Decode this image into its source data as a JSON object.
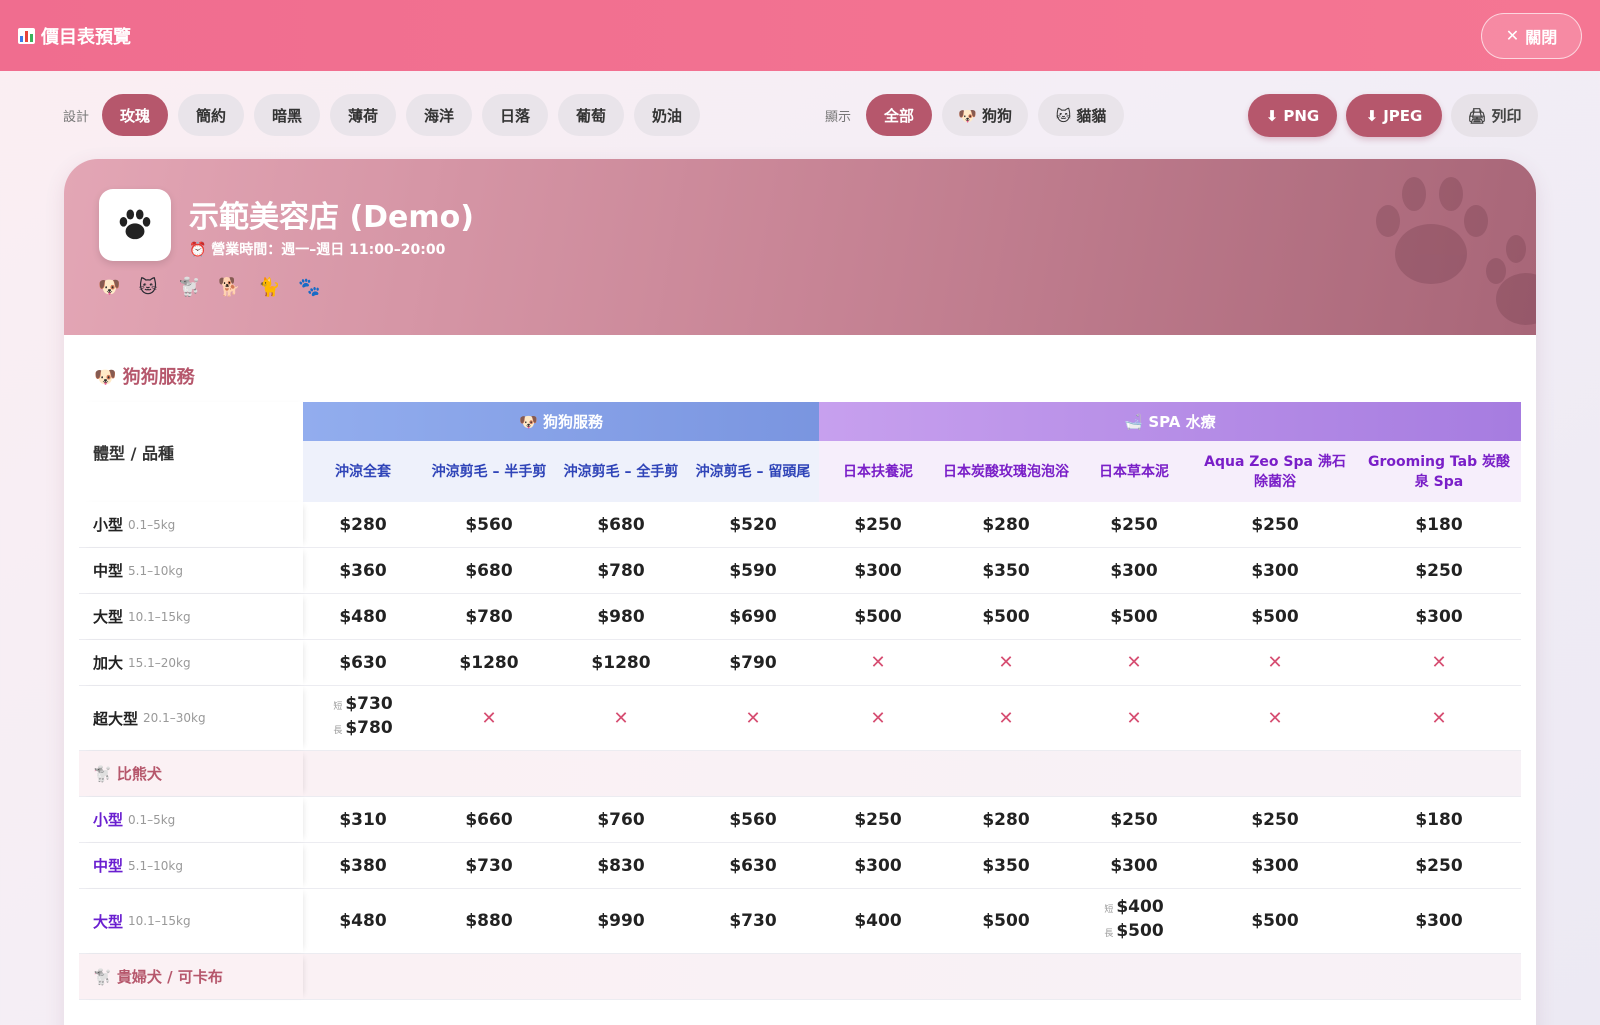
{
  "window": {
    "title": "價目表預覽",
    "close_label": "關閉"
  },
  "toolbar": {
    "design_label": "設計",
    "themes": [
      "玫瑰",
      "簡約",
      "暗黑",
      "薄荷",
      "海洋",
      "日落",
      "葡萄",
      "奶油"
    ],
    "active_theme": "玫瑰",
    "display_label": "顯示",
    "filters": [
      "全部",
      "🐶 狗狗",
      "🐱 貓貓"
    ],
    "active_filter": "全部",
    "png_label": "PNG",
    "jpeg_label": "JPEG",
    "print_label": "列印"
  },
  "shop": {
    "name": "示範美容店 (Demo)",
    "hours": "⏰ 營業時間：週一–週日 11:00–20:00",
    "emojis": [
      "🐶",
      "🐱",
      "🐩",
      "🐕",
      "🐈",
      "🐾"
    ]
  },
  "section": {
    "title": "🐶 狗狗服務"
  },
  "table": {
    "label_header": "體型 / 品種",
    "groups": [
      {
        "name": "🐶 狗狗服務",
        "span": 4,
        "color": "#7f9ae6"
      },
      {
        "name": "🛁 SPA 水療",
        "span": 5,
        "color": "#b98ce8"
      }
    ],
    "columns": [
      "沖涼全套",
      "沖涼剪毛 – 半手剪",
      "沖涼剪毛 – 全手剪",
      "沖涼剪毛 – 留頭尾",
      "日本扶養泥",
      "日本炭酸玫瑰泡泡浴",
      "日本草本泥",
      "Aqua Zeo Spa 沸石除菌浴",
      "Grooming Tab 炭酸泉 Spa"
    ],
    "rows": [
      {
        "type": "size",
        "name": "小型",
        "weight": "0.1–5kg",
        "cells": [
          "$280",
          "$560",
          "$680",
          "$520",
          "$250",
          "$280",
          "$250",
          "$250",
          "$180"
        ]
      },
      {
        "type": "size",
        "name": "中型",
        "weight": "5.1–10kg",
        "cells": [
          "$360",
          "$680",
          "$780",
          "$590",
          "$300",
          "$350",
          "$300",
          "$300",
          "$250"
        ]
      },
      {
        "type": "size",
        "name": "大型",
        "weight": "10.1–15kg",
        "cells": [
          "$480",
          "$780",
          "$980",
          "$690",
          "$500",
          "$500",
          "$500",
          "$500",
          "$300"
        ]
      },
      {
        "type": "size",
        "name": "加大",
        "weight": "15.1–20kg",
        "cells": [
          "$630",
          "$1280",
          "$1280",
          "$790",
          "×",
          "×",
          "×",
          "×",
          "×"
        ]
      },
      {
        "type": "size",
        "name": "超大型",
        "weight": "20.1–30kg",
        "cells": [
          [
            "短",
            "$730",
            "長",
            "$780"
          ],
          "×",
          "×",
          "×",
          "×",
          "×",
          "×",
          "×",
          "×"
        ]
      },
      {
        "type": "breed",
        "name": "🐩 比熊犬"
      },
      {
        "type": "size",
        "purple": true,
        "name": "小型",
        "weight": "0.1–5kg",
        "cells": [
          "$310",
          "$660",
          "$760",
          "$560",
          "$250",
          "$280",
          "$250",
          "$250",
          "$180"
        ]
      },
      {
        "type": "size",
        "purple": true,
        "name": "中型",
        "weight": "5.1–10kg",
        "cells": [
          "$380",
          "$730",
          "$830",
          "$630",
          "$300",
          "$350",
          "$300",
          "$300",
          "$250"
        ]
      },
      {
        "type": "size",
        "purple": true,
        "name": "大型",
        "weight": "10.1–15kg",
        "cells": [
          "$480",
          "$880",
          "$990",
          "$730",
          "$400",
          "$500",
          [
            "短",
            "$400",
            "長",
            "$500"
          ],
          "$500",
          "$300"
        ]
      },
      {
        "type": "breed",
        "name": "🐩 貴婦犬 / 可卡布"
      }
    ]
  },
  "colors": {
    "accent": "#b6576c",
    "topbar": "#f26f90",
    "cross": "#d64d71"
  },
  "icons": {
    "download": "download-icon",
    "print": "printer-icon",
    "close": "close-icon"
  }
}
